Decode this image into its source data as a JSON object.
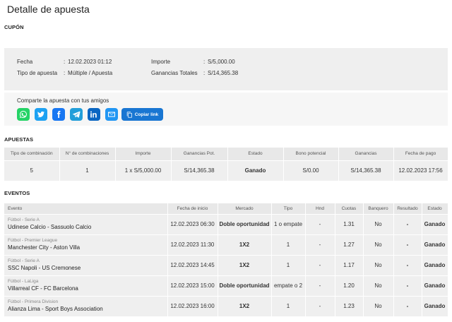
{
  "title": "Detalle de apuesta",
  "coupon": {
    "section_label": "CUPÓN",
    "fields": [
      {
        "label": "Fecha",
        "value": "12.02.2023 01:12"
      },
      {
        "label": "Tipo de apuesta",
        "value": "Múltiple / Apuesta"
      },
      {
        "label": "Importe",
        "value": "S/5,000.00"
      },
      {
        "label": "Ganancias Totales",
        "value": "S/14,365.38"
      }
    ],
    "share": {
      "text": "Comparte la apuesta con tus amigos",
      "icons": [
        {
          "name": "whatsapp-icon",
          "color": "#25d366"
        },
        {
          "name": "twitter-icon",
          "color": "#1da1f2"
        },
        {
          "name": "facebook-icon",
          "color": "#1877f2"
        },
        {
          "name": "telegram-icon",
          "color": "#229ed9"
        },
        {
          "name": "linkedin-icon",
          "color": "#0a66c2"
        },
        {
          "name": "email-icon",
          "color": "#2196f3"
        }
      ],
      "copy_label": "Copiar link"
    }
  },
  "apuestas": {
    "section_label": "APUESTAS",
    "headers": [
      "Tipo de combinación",
      "N° de combinaciones",
      "Importe",
      "Ganancias Pot.",
      "Estado",
      "Bono potencial",
      "Ganancias",
      "Fecha de pago"
    ],
    "row": [
      "5",
      "1",
      "1 x S/5,000.00",
      "S/14,365.38",
      "Ganado",
      "S/0.00",
      "S/14,365.38",
      "12.02.2023 17:56"
    ]
  },
  "eventos": {
    "section_label": "EVENTOS",
    "headers": [
      "Evento",
      "Fecha de inicio",
      "Mercado",
      "Tipo",
      "Hnd",
      "Cuotas",
      "Banquero",
      "Resultado",
      "Estado"
    ],
    "rows": [
      {
        "league": "Fútbol - Serie A",
        "match": "Udinese Calcio - Sassuolo Calcio",
        "date": "12.02.2023 06:30",
        "market": "Doble oportunidad",
        "type": "1 o empate",
        "hnd": "-",
        "odds": "1.31",
        "banker": "No",
        "result": "-",
        "status": "Ganado"
      },
      {
        "league": "Fútbol - Premier League",
        "match": "Manchester City - Aston Villa",
        "date": "12.02.2023 11:30",
        "market": "1X2",
        "type": "1",
        "hnd": "-",
        "odds": "1.27",
        "banker": "No",
        "result": "-",
        "status": "Ganado"
      },
      {
        "league": "Fútbol - Serie A",
        "match": "SSC Napoli - US Cremonese",
        "date": "12.02.2023 14:45",
        "market": "1X2",
        "type": "1",
        "hnd": "-",
        "odds": "1.17",
        "banker": "No",
        "result": "-",
        "status": "Ganado"
      },
      {
        "league": "Fútbol - LaLiga",
        "match": "Villarreal CF - FC Barcelona",
        "date": "12.02.2023 15:00",
        "market": "Doble oportunidad",
        "type": "empate o 2",
        "hnd": "-",
        "odds": "1.20",
        "banker": "No",
        "result": "-",
        "status": "Ganado"
      },
      {
        "league": "Fútbol - Primera Division",
        "match": "Alianza Lima - Sport Boys Association",
        "date": "12.02.2023 16:00",
        "market": "1X2",
        "type": "1",
        "hnd": "-",
        "odds": "1.23",
        "banker": "No",
        "result": "-",
        "status": "Ganado"
      }
    ]
  },
  "colors": {
    "accent": "#1976d2",
    "market": "#ef6c00",
    "won": "#2e9e3e"
  }
}
